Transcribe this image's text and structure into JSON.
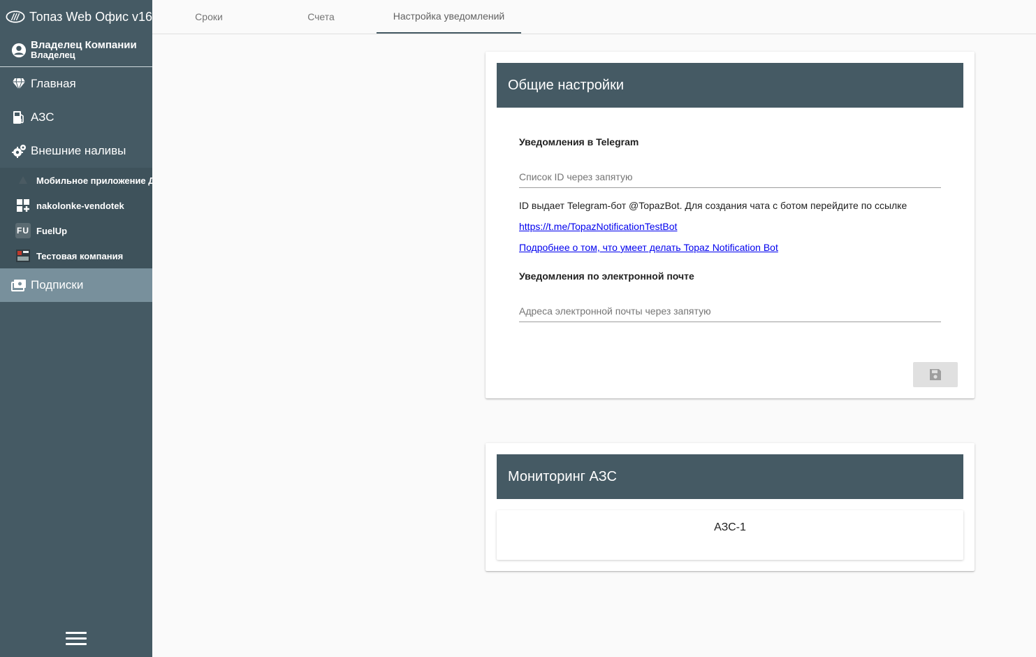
{
  "app": {
    "title": "Топаз Web Офис v16",
    "logo": "topaz-logo"
  },
  "user": {
    "name": "Владелец Компании",
    "role": "Владелец"
  },
  "sidebar": {
    "items": [
      {
        "label": "Главная",
        "icon": "diamond-icon"
      },
      {
        "label": "АЗС",
        "icon": "fuel-pump-icon"
      },
      {
        "label": "Внешние наливы",
        "icon": "gears-icon"
      }
    ],
    "sub_items": [
      {
        "label": "Мобильное приложение ДЦ",
        "icon": "mobile-app-icon"
      },
      {
        "label": "nakolonke-vendotek",
        "icon": "grid-plus-icon"
      },
      {
        "label": "FuelUp",
        "icon": "fuelup-icon",
        "icon_text": "FU"
      },
      {
        "label": "Тестовая компания",
        "icon": "test-company-icon"
      }
    ],
    "active_item": {
      "label": "Подписки",
      "icon": "subscription-icon"
    },
    "menu_icon": "hamburger-icon"
  },
  "tabs": [
    {
      "label": "Сроки"
    },
    {
      "label": "Счета"
    },
    {
      "label": "Настройка уведомлений",
      "active": true
    }
  ],
  "general_settings": {
    "title": "Общие настройки",
    "telegram": {
      "title": "Уведомления в Telegram",
      "placeholder": "Список ID через запятую",
      "value": "",
      "info": "ID выдает Telegram-бот @TopazBot. Для создания чата с ботом перейдите по ссылке",
      "link": "https://t.me/TopazNotificationTestBot",
      "more_link": "Подробнее о том, что умеет делать Topaz Notification Bot"
    },
    "email": {
      "title": "Уведомления по электронной почте",
      "placeholder": "Адреса электронной почты через запятую",
      "value": ""
    },
    "save_icon": "save-icon"
  },
  "monitoring": {
    "title": "Мониторинг АЗС",
    "stations": [
      "АЗС-1"
    ]
  },
  "colors": {
    "sidebar": "#455a64",
    "active_item": "#78909c",
    "card_header": "#455a64",
    "link": "#0000ee"
  }
}
